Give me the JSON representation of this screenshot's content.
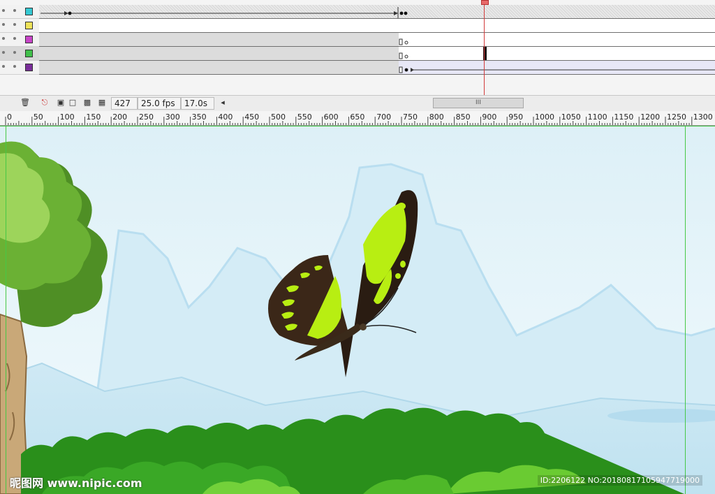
{
  "timeline": {
    "layers": [
      {
        "color": "#35c9d3",
        "selected": false
      },
      {
        "color": "#eee35a",
        "selected": false
      },
      {
        "color": "#c845c8",
        "selected": false
      },
      {
        "color": "#40c04a",
        "selected": true
      },
      {
        "color": "#7a2e9a",
        "selected": false
      }
    ],
    "current_frame": "427",
    "fps": "25.0 fps",
    "elapsed": "17.0s",
    "scroll_grip": "III"
  },
  "ruler": {
    "labels": [
      "0",
      "50",
      "100",
      "150",
      "200",
      "250",
      "300",
      "350",
      "400",
      "450",
      "500",
      "550",
      "600",
      "650",
      "700",
      "750",
      "800",
      "850",
      "900",
      "950",
      "1000",
      "1050",
      "1100",
      "1150",
      "1200",
      "1250",
      "1300"
    ]
  },
  "watermark": {
    "site": "昵图网 www.nipic.com",
    "id": "ID:2206122 NO:20180817105947719000"
  },
  "colors": {
    "sky_top": "#dff1f8",
    "mountain": "#c8e6f2",
    "tree_light": "#8dcf4a",
    "tree_dark": "#4f8f25",
    "bush": "#2f9c1e",
    "butterfly_dark": "#2a1c12",
    "butterfly_spots": "#b8ee12"
  }
}
